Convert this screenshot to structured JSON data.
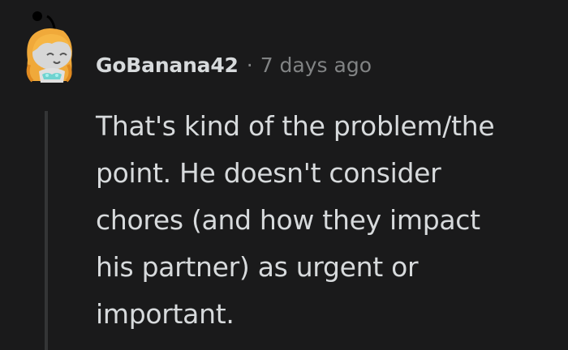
{
  "comment": {
    "author": "GoBanana42",
    "separator": "·",
    "timestamp": "7 days ago",
    "body_lines": [
      "That's kind of the problem/the",
      "point. He doesn't consider",
      "chores (and how they impact",
      "his partner) as urgent or",
      "important."
    ],
    "avatar_icon": "snoo-avatar-icon"
  },
  "colors": {
    "background": "#1a1a1b",
    "text": "#d7dadc",
    "meta": "#818384",
    "thread_line": "#343536"
  }
}
